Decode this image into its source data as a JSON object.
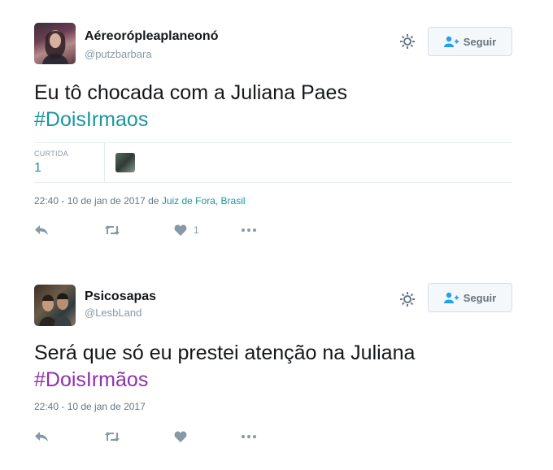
{
  "tweets": [
    {
      "display_name": "Aéreorópleaplaneonó",
      "screen_name": "@putzbarbara",
      "text": "Eu tô chocada com a Juliana Paes",
      "hashtag": "#DoisIrmaos",
      "stats": {
        "label": "CURTIDA",
        "value": "1"
      },
      "timestamp": "22:40 - 10 de jan de 2017",
      "location_prefix": "de",
      "location": "Juiz de Fora, Brasil",
      "like_count": "1",
      "follow_label": "Seguir",
      "icons": {
        "settings": "gear-icon",
        "follow": "add-user-icon",
        "reply": "reply-icon",
        "retweet": "retweet-icon",
        "like": "heart-icon",
        "more": "more-icon"
      }
    },
    {
      "display_name": "Psicosapas",
      "screen_name": "@LesbLand",
      "text": "Será que só eu prestei atenção na Juliana",
      "hashtag": "#DoisIrmãos",
      "timestamp": "22:40 - 10 de jan de 2017",
      "follow_label": "Seguir",
      "icons": {
        "settings": "gear-icon",
        "follow": "add-user-icon",
        "reply": "reply-icon",
        "retweet": "retweet-icon",
        "like": "heart-icon",
        "more": "more-icon"
      }
    }
  ],
  "colors": {
    "hashtag_1": "#1b95a0",
    "hashtag_2": "#8e2fb0",
    "muted": "#8899a6",
    "border": "#e6ecf0"
  }
}
